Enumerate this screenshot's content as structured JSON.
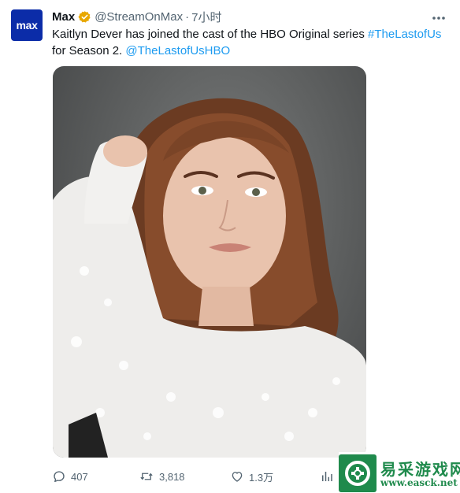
{
  "account": {
    "avatar_text": "max",
    "name": "Max",
    "handle": "@StreamOnMax",
    "separator": "·",
    "time": "7小时"
  },
  "tweet": {
    "text_before": "Kaitlyn Dever has joined the cast of the HBO Original series ",
    "hashtag": "#TheLastofUs",
    "text_after": " for Season 2. ",
    "mention": "@TheLastofUsHBO"
  },
  "actions": {
    "replies": "407",
    "retweets": "3,818",
    "likes": "1.3万"
  },
  "watermark": {
    "title": "易采游戏网",
    "url": "www.easck.net"
  },
  "colors": {
    "link": "#1d9bf0",
    "muted": "#536471",
    "avatar_bg": "#0b2ca8",
    "verified": "#e8a800",
    "watermark_green": "#1f8a4c"
  }
}
